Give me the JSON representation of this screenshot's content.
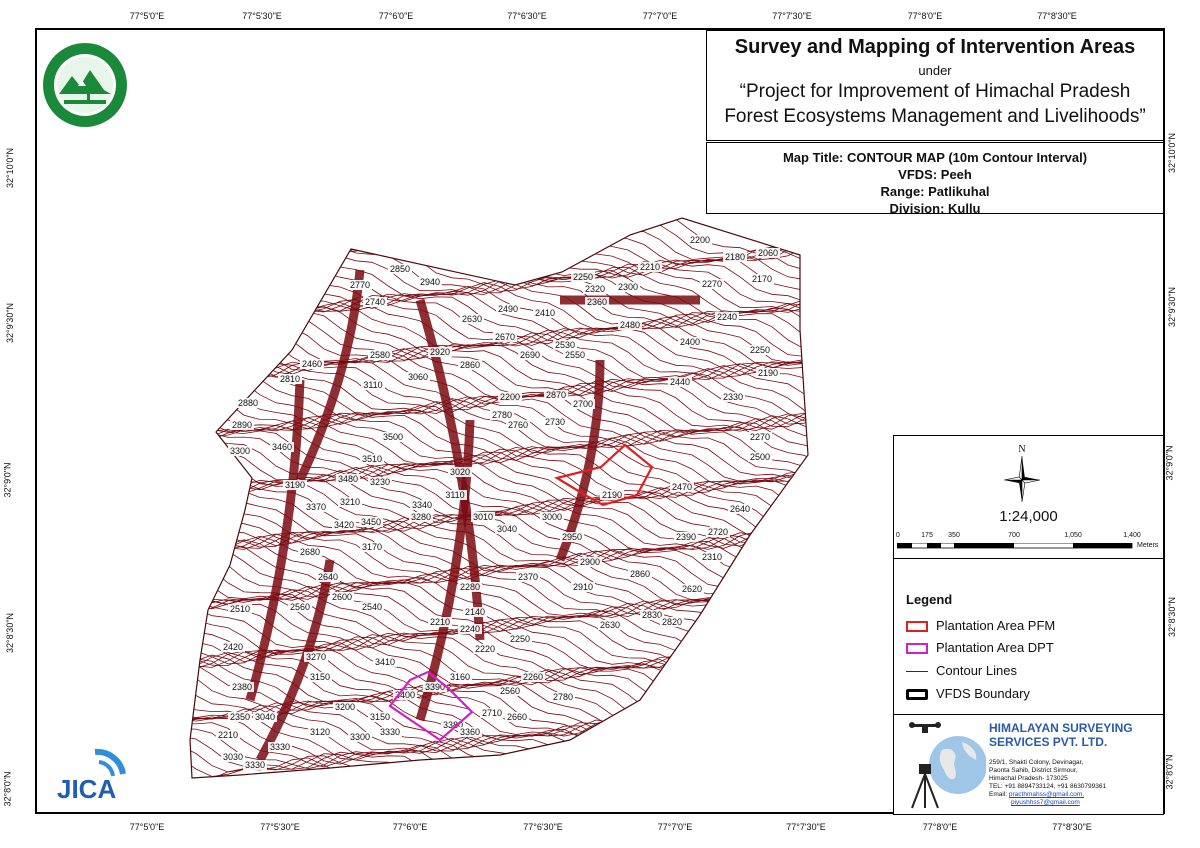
{
  "title": {
    "main": "Survey and Mapping of Intervention Areas",
    "under": "under",
    "project_line1": "“Project for Improvement of Himachal Pradesh",
    "project_line2": "Forest Ecosystems Management and Livelihoods”"
  },
  "info": {
    "map_title": "Map Title: CONTOUR MAP (10m Contour Interval)",
    "vfds": "VFDS: Peeh",
    "range": "Range: Patlikuhal",
    "division": "Division: Kullu"
  },
  "graticule": {
    "longitudes": [
      "77°5'0\"E",
      "77°5'30\"E",
      "77°6'0\"E",
      "77°6'30\"E",
      "77°7'0\"E",
      "77°7'30\"E",
      "77°8'0\"E",
      "77°8'30\"E"
    ],
    "latitudes": [
      "32°10'0\"N",
      "32°9'30\"N",
      "32°9'0\"N",
      "32°8'30\"N",
      "32°8'0\"N"
    ]
  },
  "north_arrow": {
    "label": "N"
  },
  "scale": {
    "ratio": "1:24,000",
    "ticks": [
      "0",
      "175",
      "350",
      "700",
      "1,050",
      "1,400"
    ],
    "unit": "Meters"
  },
  "legend": {
    "title": "Legend",
    "items": [
      {
        "label": "Plantation Area PFM",
        "color": "#e02020",
        "kind": "outline"
      },
      {
        "label": "Plantation Area DPT",
        "color": "#d21fc8",
        "kind": "outline"
      },
      {
        "label": "Contour Lines",
        "color": "#7a0a12",
        "kind": "line"
      },
      {
        "label": "VFDS Boundary",
        "color": "#000000",
        "kind": "outline-thick"
      }
    ]
  },
  "company": {
    "name_line1": "HIMALAYAN SURVEYING",
    "name_line2": "SERVICES PVT. LTD.",
    "address": [
      "259/1, Shakti Colony, Devinagar,",
      "Paonta Sahib, District Sirmour,",
      "Himachal Pradesh- 173025",
      "TEL: +91 8894733124, +91 8630799361"
    ],
    "email_label": "Email:",
    "emails": [
      "practhmahss@gmail.com,",
      "piyushhss7@gmail.com"
    ]
  },
  "logos": {
    "forest_dept": "Himachal Pradesh Forest Department emblem",
    "jica_text": "JICA"
  },
  "contour_labels": [
    "2590",
    "2570",
    "2800",
    "2780",
    "2970",
    "3100",
    "3180",
    "3110",
    "3060",
    "2920",
    "2630",
    "2670",
    "2690",
    "2860",
    "2410",
    "2490",
    "2530",
    "2550",
    "2480",
    "2320",
    "2300",
    "2250",
    "2360",
    "2210",
    "2200",
    "2180",
    "2060",
    "2170",
    "2270",
    "2240",
    "2400",
    "2190",
    "2250",
    "2330",
    "2440",
    "2190",
    "2200",
    "2870",
    "2700",
    "2730",
    "2780",
    "2760",
    "2880",
    "2890",
    "3300",
    "3460",
    "3480",
    "3500",
    "3510",
    "3230",
    "3210",
    "3190",
    "3370",
    "3420",
    "3450",
    "3340",
    "3280",
    "3170",
    "3110",
    "3020",
    "3010",
    "3040",
    "3000",
    "2950",
    "2900",
    "2910",
    "2860",
    "2830",
    "2820",
    "2630",
    "2620",
    "2720",
    "2640",
    "2500",
    "2470",
    "2390",
    "2310",
    "2270",
    "2370",
    "2280",
    "2140",
    "2240",
    "2220",
    "2210",
    "2250",
    "2260",
    "2560",
    "2710",
    "2660",
    "2780",
    "2680",
    "2640",
    "2600",
    "2560",
    "2540",
    "2510",
    "2420",
    "2380",
    "2350",
    "2210",
    "3330",
    "3330",
    "3270",
    "3150",
    "3200",
    "3410",
    "3400",
    "3390",
    "3380",
    "3360",
    "3330",
    "3300",
    "3150",
    "3160",
    "3120",
    "3030",
    "3040",
    "2850",
    "2940",
    "2770",
    "2740",
    "2580",
    "2460",
    "2810"
  ]
}
